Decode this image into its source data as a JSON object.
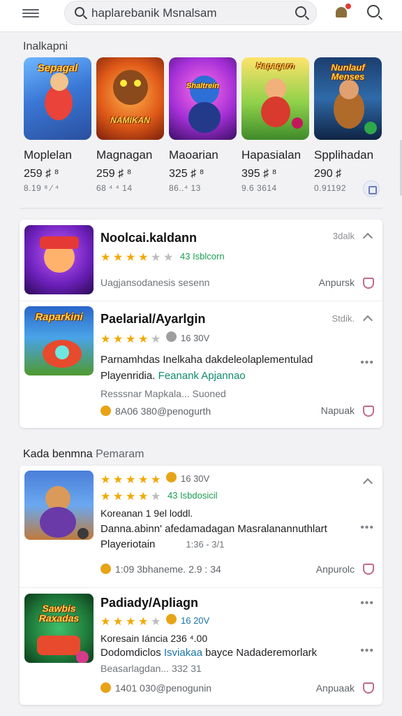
{
  "search": {
    "value": "haplarebanik Msnalsam"
  },
  "section1": {
    "title": "Inalkapni"
  },
  "games": [
    {
      "logo": "Sepagal",
      "name": "Moplelan",
      "price": "259 ♯ ⁸",
      "sub": "8.19 ⁸ ⁄ ⁴"
    },
    {
      "logo": "NAMIKAN",
      "name": "Magnagan",
      "price": "259 ♯ ⁸",
      "sub": "68 ⁴ ⁴ 14"
    },
    {
      "logo": "Shaltrein",
      "name": "Maoarian",
      "price": "325 ♯ ⁸",
      "sub": "86..⁴ 13"
    },
    {
      "logo": "Hapagarn",
      "name": "Hapasialan",
      "price": "395 ♯ ⁸",
      "sub": "9.6 3614"
    },
    {
      "logo": "Nunlauf Menses",
      "name": "Spplihadan",
      "price": "290 ♯",
      "sub": "0.91192"
    }
  ],
  "card1": {
    "rows": [
      {
        "title": "Noolcai.kaldann",
        "meta": "43 Isblcorn",
        "line1": "Uagjansodanesis sesenn",
        "size": "3dalk",
        "action": "Anpursk"
      },
      {
        "logo": "Raparkini",
        "title": "Paelarial/Ayarlgin",
        "meta": "16 30V",
        "line1": "Parnamhdas Inelkaha dakdeleolaplementulad",
        "line2a": "Playenridia.",
        "line2b": "Feanank Apjannao",
        "line3": "Resssnar Mapkala...  Suoned",
        "foot": "8A06 380@penogurth",
        "size": "Stdik.",
        "action": "Napuak"
      }
    ]
  },
  "section2": {
    "title_a": "Kada benmna",
    "title_b": "Pemaram"
  },
  "card2": {
    "rows": [
      {
        "meta1": "16 30V",
        "meta2": "43 Isbdosicil",
        "line1": "Koreanan 1 9el loddl.",
        "line2": "Danna.abinn' afedamadagan Masralanannuthlart",
        "line3": "Playeriotain",
        "line3b": "1:36 - 3/1",
        "foot": "1:09 3bhaneme. 2.9 : 34",
        "action": "Anpurolc"
      },
      {
        "logo": "Sawbis Raxadas",
        "title": "Padiady/Apliagn",
        "meta": "16 20V",
        "line1": "Koresain Iáncia 236 ⁴.00",
        "line2a": "Dodomdiclos",
        "line2b": "Isviakaa",
        "line2c": "bayce Nadaderemorlark",
        "line3": "Beasarlagdan...  332 31",
        "foot": "1401 030@penogunin",
        "action": "Anpuaak"
      }
    ]
  }
}
